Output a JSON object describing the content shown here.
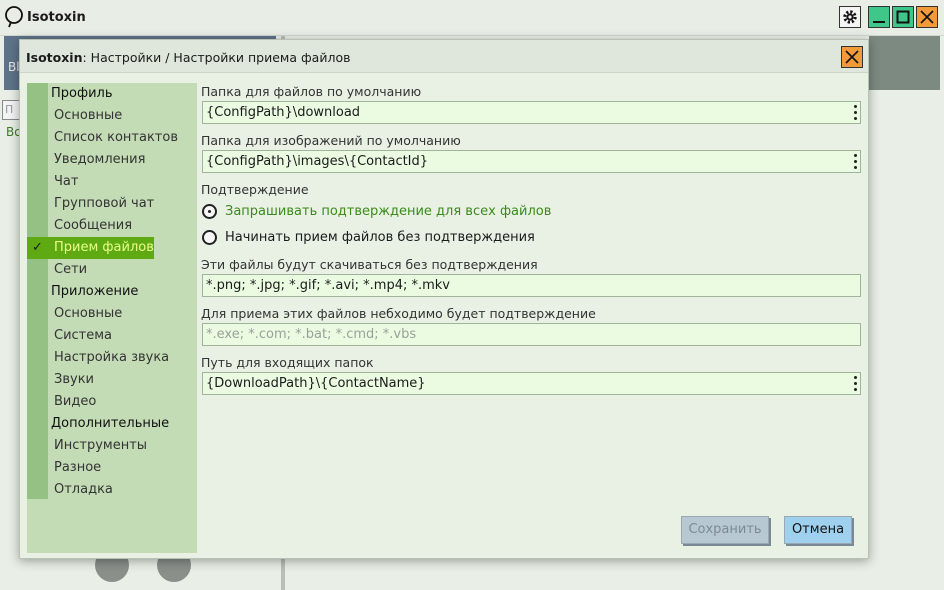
{
  "app": {
    "title": "Isotoxin",
    "bg_strip_text": "Bl",
    "bg_input_placeholder": "П",
    "bg_label": "Во"
  },
  "dialog": {
    "title_app": "Isotoxin",
    "title_path": ": Настройки / Настройки приема файлов"
  },
  "sidebar": {
    "items": [
      {
        "label": "Профиль",
        "kind": "group"
      },
      {
        "label": "Основные",
        "kind": "sub"
      },
      {
        "label": "Список контактов",
        "kind": "sub"
      },
      {
        "label": "Уведомления",
        "kind": "sub"
      },
      {
        "label": "Чат",
        "kind": "sub"
      },
      {
        "label": "Групповой чат",
        "kind": "sub"
      },
      {
        "label": "Сообщения",
        "kind": "sub"
      },
      {
        "label": "Прием файлов",
        "kind": "sub",
        "active": true
      },
      {
        "label": "Сети",
        "kind": "sub"
      },
      {
        "label": "Приложение",
        "kind": "group"
      },
      {
        "label": "Основные",
        "kind": "sub"
      },
      {
        "label": "Система",
        "kind": "sub"
      },
      {
        "label": "Настройка звука",
        "kind": "sub"
      },
      {
        "label": "Звуки",
        "kind": "sub"
      },
      {
        "label": "Видео",
        "kind": "sub"
      },
      {
        "label": "Дополнительные",
        "kind": "group"
      },
      {
        "label": "Инструменты",
        "kind": "sub"
      },
      {
        "label": "Разное",
        "kind": "sub"
      },
      {
        "label": "Отладка",
        "kind": "sub"
      }
    ],
    "active_check": "✓"
  },
  "form": {
    "default_folder_label": "Папка для файлов по умолчанию",
    "default_folder_value": "{ConfigPath}\\download",
    "images_folder_label": "Папка для изображений по умолчанию",
    "images_folder_value": "{ConfigPath}\\images\\{ContactId}",
    "confirm_label": "Подтверждение",
    "radio_ask_all": "Запрашивать подтверждение для всех файлов",
    "radio_no_confirm": "Начинать прием файлов без подтверждения",
    "radio_selected": "ask_all",
    "auto_files_label": "Эти файлы будут скачиваться без подтверждения",
    "auto_files_value": "*.png; *.jpg; *.gif; *.avi; *.mp4; *.mkv",
    "confirm_files_label": "Для приема этих файлов небходимо будет подтверждение",
    "confirm_files_placeholder": "*.exe; *.com; *.bat; *.cmd; *.vbs",
    "incoming_path_label": "Путь для входящих папок",
    "incoming_path_value": "{DownloadPath}\\{ContactName}"
  },
  "buttons": {
    "save": "Сохранить",
    "cancel": "Отмена"
  },
  "colors": {
    "accent_green": "#5faa12",
    "close_orange": "#f29a3a",
    "minmax_green": "#3fc78a"
  }
}
